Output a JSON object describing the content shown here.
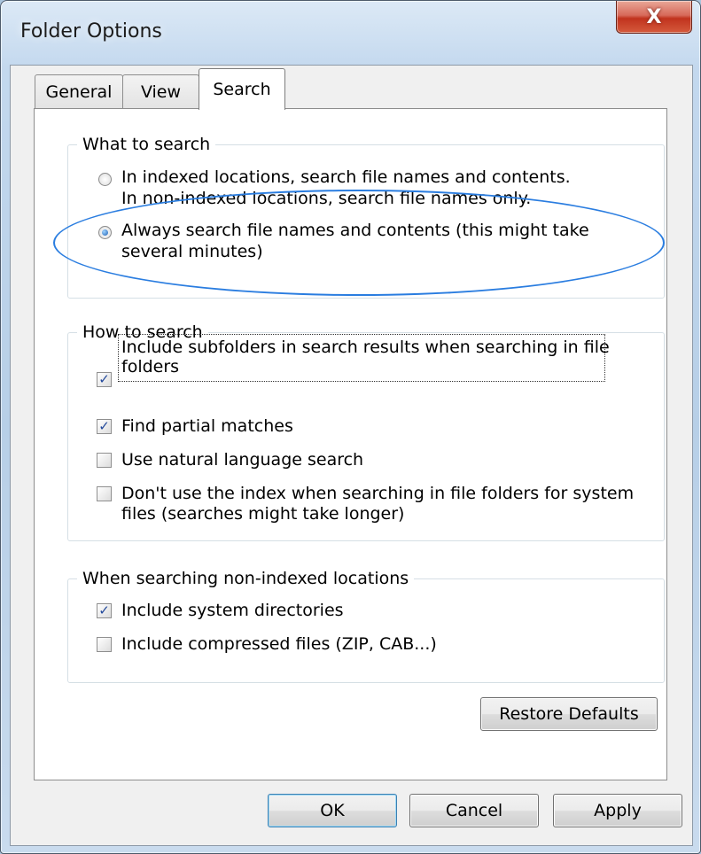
{
  "window": {
    "title": "Folder Options",
    "close_glyph": "X"
  },
  "tabs": [
    {
      "label": "General",
      "active": false
    },
    {
      "label": "View",
      "active": false
    },
    {
      "label": "Search",
      "active": true
    }
  ],
  "what_to_search": {
    "title": "What to search",
    "option1": {
      "line1": "In indexed locations, search file names and contents.",
      "line2": "In non-indexed locations, search file names only.",
      "selected": false
    },
    "option2": {
      "line1": "Always search file names and contents (this might take",
      "line2": "several minutes)",
      "selected": true
    }
  },
  "how_to_search": {
    "title": "How to search",
    "items": [
      {
        "line1": "Include subfolders in search results when searching in file",
        "line2": "folders",
        "checked": true
      },
      {
        "line1": "Find partial matches",
        "checked": true
      },
      {
        "line1": "Use natural language search",
        "checked": false
      },
      {
        "line1": "Don't use the index when searching in file folders for system",
        "line2": "files (searches might take longer)",
        "checked": false
      }
    ]
  },
  "non_indexed": {
    "title": "When searching non-indexed locations",
    "items": [
      {
        "line1": "Include system directories",
        "checked": true
      },
      {
        "line1": "Include compressed files (ZIP, CAB...)",
        "checked": false
      }
    ]
  },
  "buttons": {
    "restore_defaults": "Restore Defaults",
    "ok": "OK",
    "cancel": "Cancel",
    "apply": "Apply"
  },
  "colors": {
    "annotation_ellipse": "#2a7de0",
    "close_button": "#c1331e"
  },
  "icons": {
    "checkmark": "✓"
  }
}
